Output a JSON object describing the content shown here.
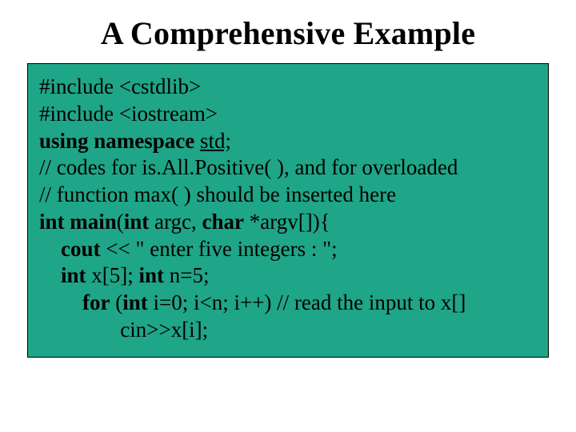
{
  "title": "A Comprehensive Example",
  "code": {
    "l1a": "#include <cstdlib>",
    "l2a": "#include <iostream>",
    "l3a": "using namespace ",
    "l3b": "std;",
    "l4a": "// codes for is.All.Positive( ), and for overloaded",
    "l5a": "// function max( ) should be inserted here",
    "l6a": "int main",
    "l6b": "(",
    "l6c": "int",
    "l6d": " argc, ",
    "l6e": "char",
    "l6f": " *argv[]){",
    "l7a": "    ",
    "l7b": "cout",
    "l7c": " << \" enter five integers : \";",
    "l8a": "    ",
    "l8b": "int",
    "l8c": " x[5]; ",
    "l8d": "int",
    "l8e": " n=5;",
    "l9a": "        ",
    "l9b": "for",
    "l9c": " (",
    "l9d": "int",
    "l9e": " i=0; i<n; i++) // read the input to x[]",
    "l10a": "               cin>>x[i];"
  }
}
